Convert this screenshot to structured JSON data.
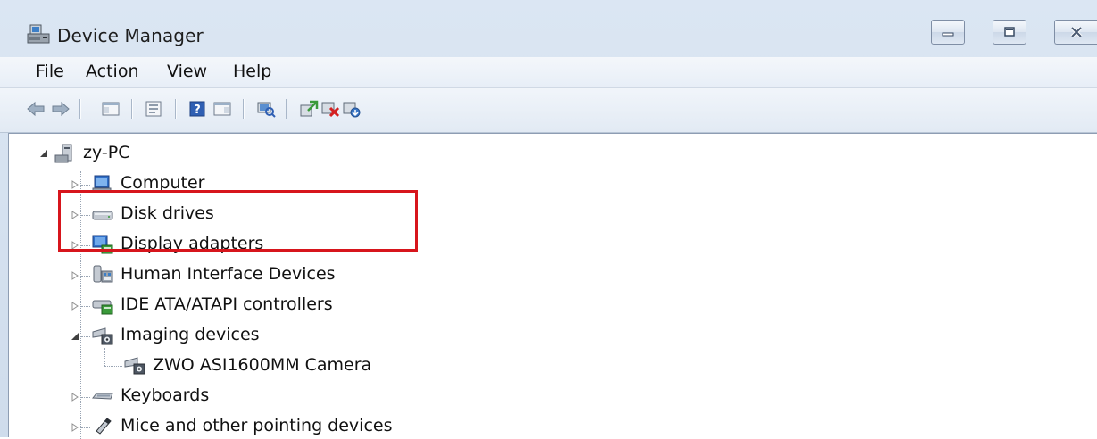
{
  "window": {
    "title": "Device Manager",
    "app_icon": "device-manager-icon"
  },
  "caption_buttons": {
    "minimize": "minimize-icon",
    "maximize": "maximize-icon",
    "close": "close-icon"
  },
  "menu": {
    "items": [
      "File",
      "Action",
      "View",
      "Help"
    ]
  },
  "toolbar": {
    "buttons": [
      "back-arrow-icon",
      "forward-arrow-icon",
      "show-hide-console-tree-icon",
      "properties-icon",
      "help-icon",
      "show-action-pane-icon",
      "scan-hardware-icon",
      "update-driver-icon",
      "disable-device-icon",
      "uninstall-device-icon"
    ]
  },
  "tree": {
    "root": {
      "label": "zy-PC",
      "icon": "computer-tower-icon",
      "expanded": true
    },
    "children": [
      {
        "label": "Computer",
        "icon": "computer-icon",
        "expanded": false
      },
      {
        "label": "Disk drives",
        "icon": "disk-drive-icon",
        "expanded": false
      },
      {
        "label": "Display adapters",
        "icon": "display-adapter-icon",
        "expanded": false
      },
      {
        "label": "Human Interface Devices",
        "icon": "hid-icon",
        "expanded": false
      },
      {
        "label": "IDE ATA/ATAPI controllers",
        "icon": "ide-controller-icon",
        "expanded": false
      },
      {
        "label": "Imaging devices",
        "icon": "camera-icon",
        "expanded": true,
        "children": [
          {
            "label": "ZWO ASI1600MM Camera",
            "icon": "camera-icon"
          }
        ]
      },
      {
        "label": "Keyboards",
        "icon": "keyboard-icon",
        "expanded": false
      },
      {
        "label": "Mice and other pointing devices",
        "icon": "mouse-icon",
        "expanded": false
      }
    ]
  },
  "colors": {
    "highlight_border": "#d7151c",
    "chrome": "#dbe6f3"
  }
}
